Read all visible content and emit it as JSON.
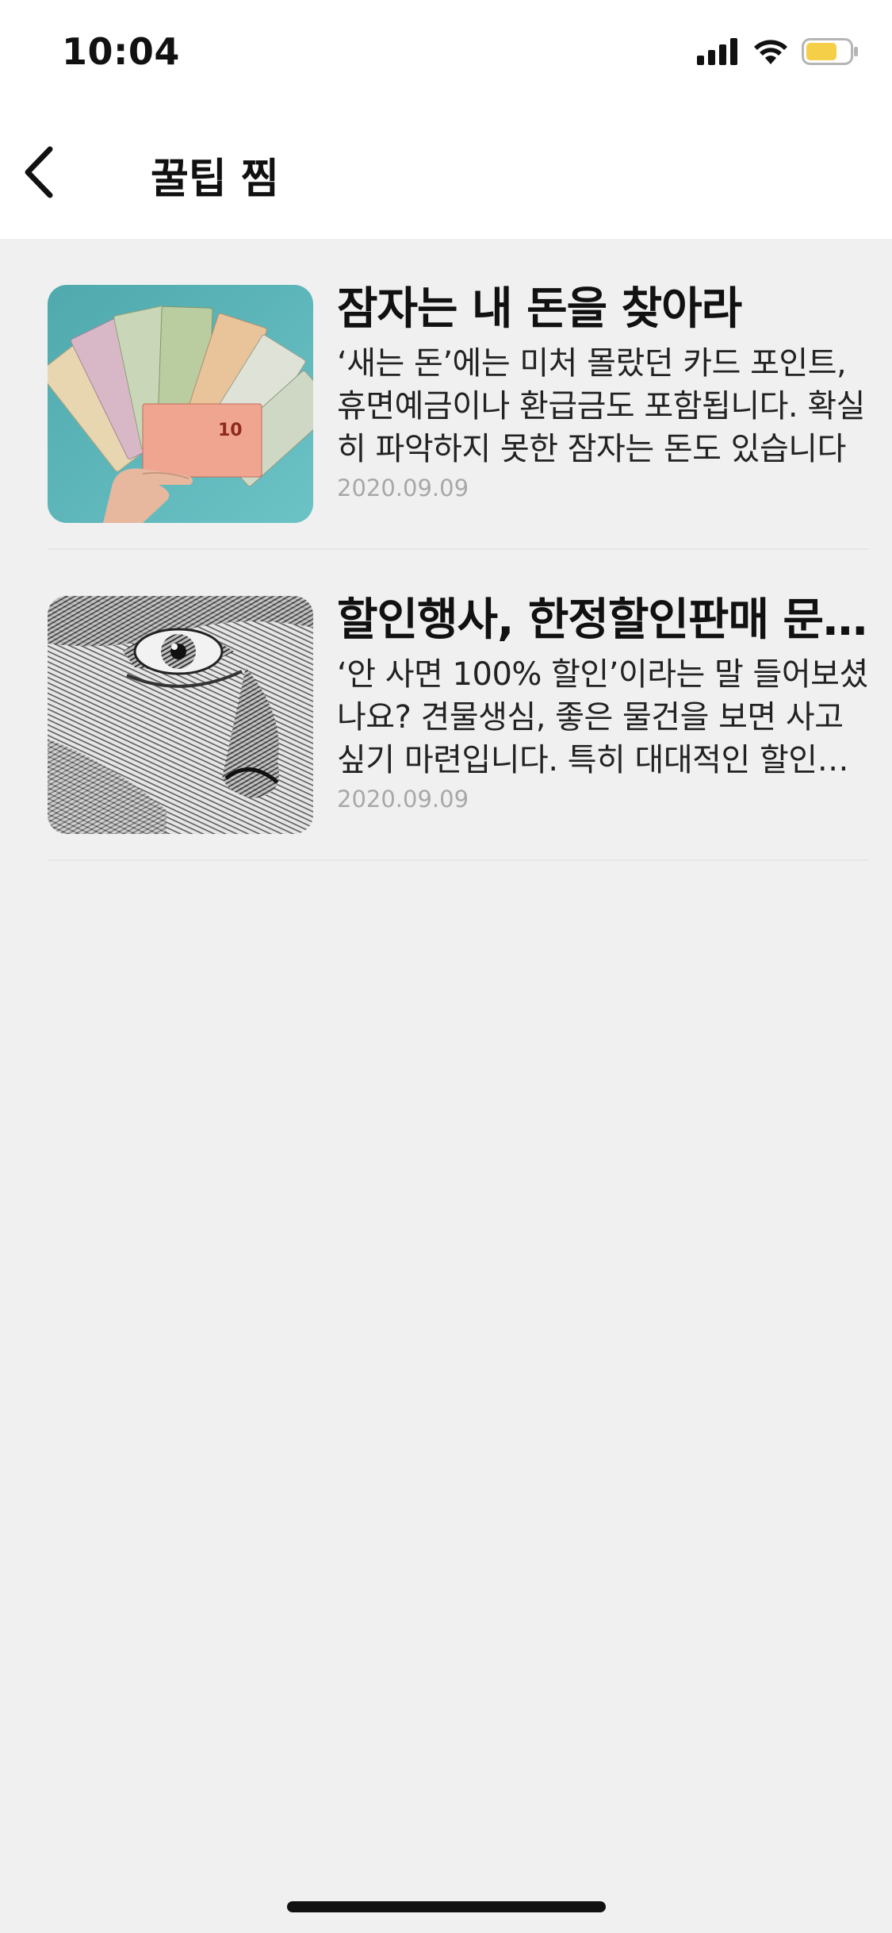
{
  "status_bar": {
    "time": "10:04",
    "battery_color": "#f5cf47"
  },
  "header": {
    "title": "꿀팁 찜",
    "back_icon": "chevron-left-icon"
  },
  "items": [
    {
      "title": "잠자는 내 돈을 찾아라",
      "description": "‘새는 돈’에는 미처 몰랐던 카드 포인트, 휴면예금이나 환급금도 포함됩니다. 확실히 파악하지 못한 잠자는 돈도 있습니다",
      "date": "2020.09.09",
      "image": "money-banknotes-fan"
    },
    {
      "title": "할인행사, 한정할인판매 문구의 유혹",
      "description": "‘안 사면 100% 할인’이라는 말 들어보셨나요? 견물생심, 좋은 물건을 보면 사고 싶기 마련입니다. 특히 대대적인 할인행사라면",
      "date": "2020.09.09",
      "image": "banknote-engraved-eye"
    }
  ]
}
